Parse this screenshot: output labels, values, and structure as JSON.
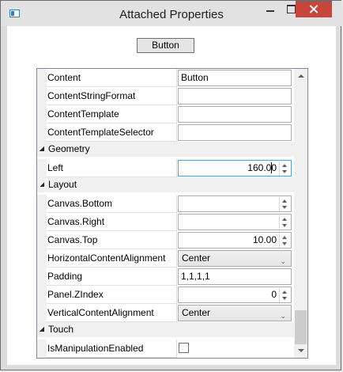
{
  "window": {
    "title": "Attached Properties"
  },
  "top_button": {
    "label": "Button"
  },
  "grid": {
    "rows": [
      {
        "kind": "prop",
        "name": "Content",
        "editor": "text",
        "value": "Button"
      },
      {
        "kind": "prop",
        "name": "ContentStringFormat",
        "editor": "text",
        "value": ""
      },
      {
        "kind": "prop",
        "name": "ContentTemplate",
        "editor": "text",
        "value": ""
      },
      {
        "kind": "prop",
        "name": "ContentTemplateSelector",
        "editor": "text",
        "value": ""
      },
      {
        "kind": "category",
        "name": "Geometry"
      },
      {
        "kind": "prop",
        "name": "Left",
        "editor": "numeric",
        "value": "160.00",
        "focused": true
      },
      {
        "kind": "category",
        "name": "Layout"
      },
      {
        "kind": "prop",
        "name": "Canvas.Bottom",
        "editor": "numeric",
        "value": ""
      },
      {
        "kind": "prop",
        "name": "Canvas.Right",
        "editor": "numeric",
        "value": ""
      },
      {
        "kind": "prop",
        "name": "Canvas.Top",
        "editor": "numeric",
        "value": "10.00"
      },
      {
        "kind": "prop",
        "name": "HorizontalContentAlignment",
        "editor": "combo",
        "value": "Center"
      },
      {
        "kind": "prop",
        "name": "Padding",
        "editor": "text",
        "value": "1,1,1,1"
      },
      {
        "kind": "prop",
        "name": "Panel.ZIndex",
        "editor": "numeric",
        "value": "0"
      },
      {
        "kind": "prop",
        "name": "VerticalContentAlignment",
        "editor": "combo",
        "value": "Center"
      },
      {
        "kind": "category",
        "name": "Touch"
      },
      {
        "kind": "prop",
        "name": "IsManipulationEnabled",
        "editor": "checkbox",
        "checked": false
      }
    ]
  },
  "scrollbar": {
    "position": 0.92
  }
}
